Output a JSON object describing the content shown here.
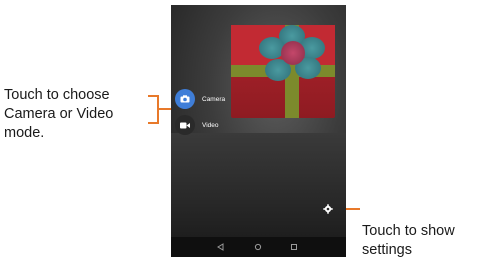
{
  "callouts": {
    "mode_line1": "Touch to choose",
    "mode_line2": "Camera or Video",
    "mode_line3": "mode.",
    "settings_line1": "Touch to show",
    "settings_line2": "settings"
  },
  "mode_switcher": {
    "camera_label": "Camera",
    "video_label": "Video",
    "selected": "Camera"
  },
  "icons": {
    "camera": "camera-icon",
    "video": "video-icon",
    "settings": "gear-icon",
    "back": "back-icon",
    "home": "home-icon",
    "recents": "recents-icon"
  },
  "colors": {
    "accent": "#3f7ed8",
    "leader": "#e8792a"
  }
}
